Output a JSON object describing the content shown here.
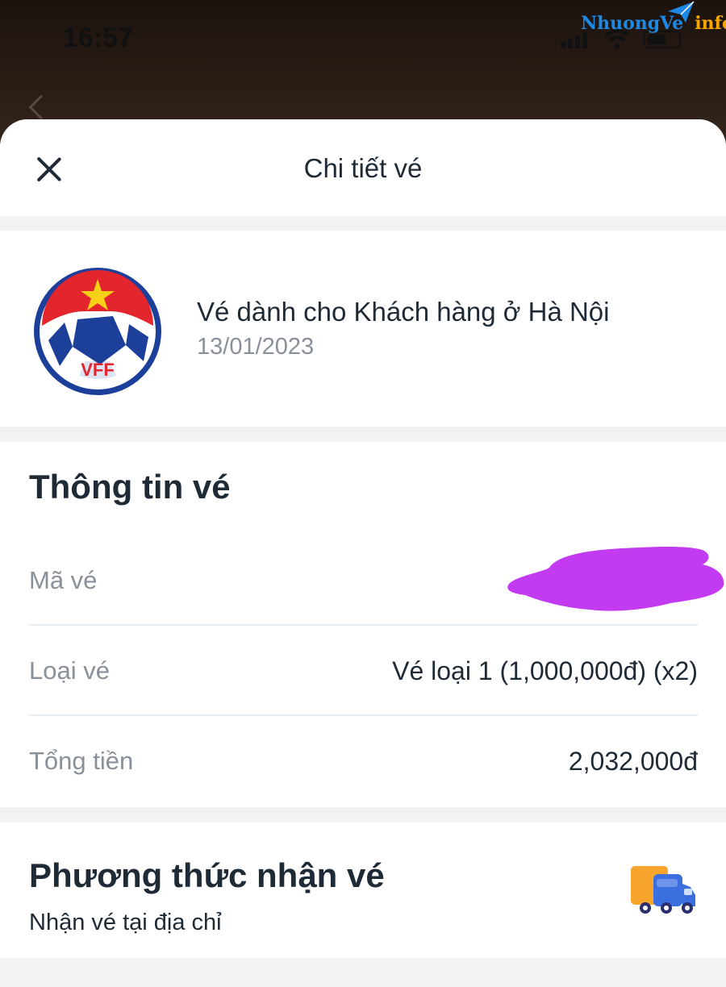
{
  "status_bar": {
    "time": "16:57"
  },
  "watermark": {
    "part1": "NhuongVe",
    "part2": "info"
  },
  "header": {
    "title": "Chi tiết vé"
  },
  "event": {
    "title": "Vé dành cho Khách hàng ở Hà Nội",
    "date": "13/01/2023",
    "logo_text": "VFF"
  },
  "ticket_info": {
    "section_title": "Thông tin vé",
    "rows": [
      {
        "label": "Mã vé",
        "value": ""
      },
      {
        "label": "Loại vé",
        "value": "Vé loại 1 (1,000,000đ) (x2)"
      },
      {
        "label": "Tổng tiền",
        "value": "2,032,000đ"
      }
    ]
  },
  "delivery": {
    "section_title": "Phương thức nhận vé",
    "method": "Nhận vé tại địa chỉ",
    "icon": "truck-icon"
  },
  "colors": {
    "accent_purple": "#c23bf0",
    "brand_red": "#e3262e",
    "brand_blue": "#1c3f9a"
  }
}
